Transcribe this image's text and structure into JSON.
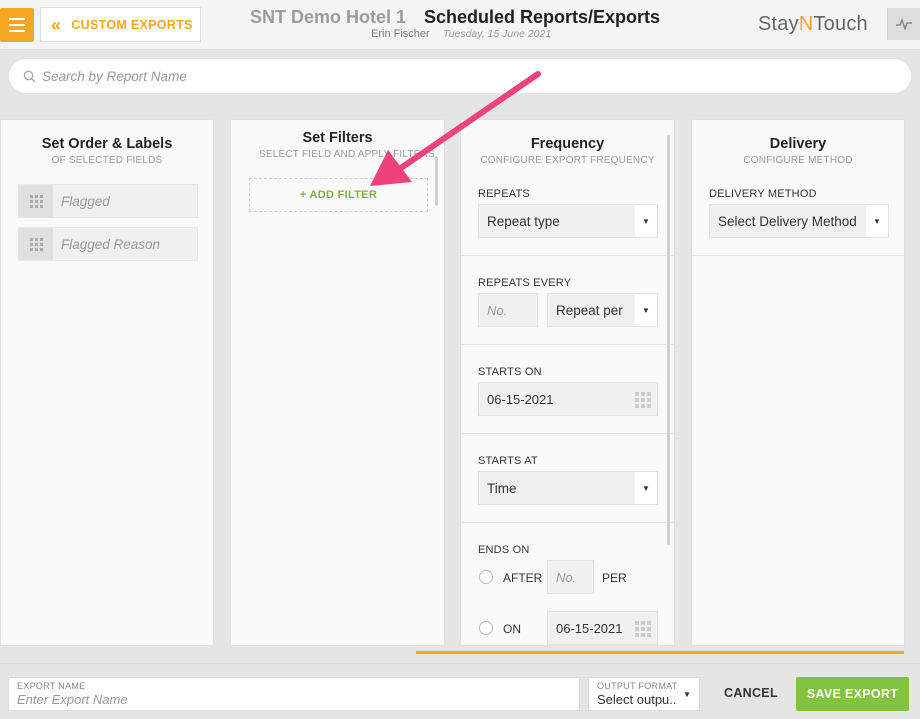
{
  "header": {
    "back_label": "CUSTOM EXPORTS",
    "hotel_name": "SNT Demo Hotel 1",
    "page_title": "Scheduled Reports/Exports",
    "user_name": "Erin Fischer",
    "date": "Tuesday, 15 June 2021",
    "logo_left": "Stay",
    "logo_mid": "N",
    "logo_right": "Touch"
  },
  "search": {
    "placeholder": "Search by Report Name"
  },
  "order_panel": {
    "title": "Set Order & Labels",
    "subtitle": "OF SELECTED FIELDS",
    "fields": [
      "Flagged",
      "Flagged Reason"
    ]
  },
  "filters_panel": {
    "title": "Set Filters",
    "subtitle": "SELECT FIELD AND APPLY FILTERS",
    "add_filter": "+ ADD FILTER"
  },
  "frequency_panel": {
    "title": "Frequency",
    "subtitle": "CONFIGURE EXPORT FREQUENCY",
    "repeats_label": "REPEATS",
    "repeat_type": "Repeat type",
    "repeats_every_label": "REPEATS EVERY",
    "number_placeholder": "No.",
    "repeat_per": "Repeat per",
    "starts_on_label": "STARTS ON",
    "starts_on_date": "06-15-2021",
    "starts_at_label": "STARTS AT",
    "time": "Time",
    "ends_on_label": "ENDS ON",
    "after_label": "AFTER",
    "after_placeholder": "No.",
    "per_label": "PER",
    "on_label": "ON",
    "ends_on_date": "06-15-2021"
  },
  "delivery_panel": {
    "title": "Delivery",
    "subtitle": "CONFIGURE METHOD",
    "method_label": "DELIVERY METHOD",
    "method_value": "Select Delivery Method"
  },
  "footer": {
    "export_name_label": "EXPORT NAME",
    "export_name_placeholder": "Enter Export Name",
    "output_format_label": "OUTPUT FORMAT",
    "output_format_value": "Select outpu..",
    "cancel": "CANCEL",
    "save": "SAVE EXPORT"
  },
  "colors": {
    "accent": "#f5a623",
    "success": "#82c341",
    "annotation": "#f0427a"
  }
}
